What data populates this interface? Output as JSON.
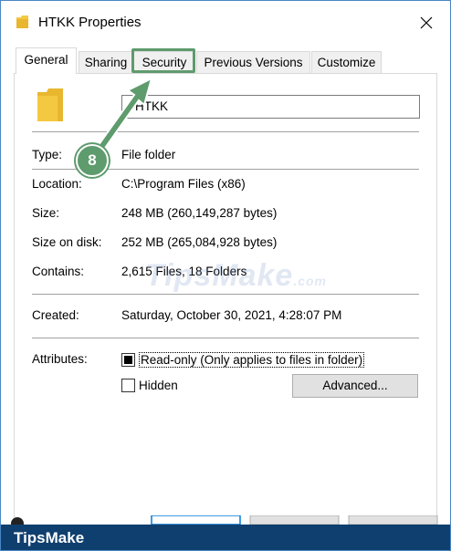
{
  "window": {
    "title": "HTKK Properties"
  },
  "tabs": [
    {
      "label": "General"
    },
    {
      "label": "Sharing"
    },
    {
      "label": "Security"
    },
    {
      "label": "Previous Versions"
    },
    {
      "label": "Customize"
    }
  ],
  "general": {
    "name_value": "HTKK",
    "rows": {
      "type": {
        "label": "Type:",
        "value": "File folder"
      },
      "location": {
        "label": "Location:",
        "value": "C:\\Program Files (x86)"
      },
      "size": {
        "label": "Size:",
        "value": "248 MB (260,149,287 bytes)"
      },
      "size_on_disk": {
        "label": "Size on disk:",
        "value": "252 MB (265,084,928 bytes)"
      },
      "contains": {
        "label": "Contains:",
        "value": "2,615 Files, 18 Folders"
      },
      "created": {
        "label": "Created:",
        "value": "Saturday, October 30, 2021, 4:28:07 PM"
      }
    },
    "attributes": {
      "label": "Attributes:",
      "readonly": {
        "label": "Read-only (Only applies to files in folder)",
        "checked": true
      },
      "hidden": {
        "label": "Hidden",
        "checked": false
      },
      "advanced_label": "Advanced..."
    }
  },
  "annotation": {
    "step": "8",
    "color": "#5e9b6d"
  },
  "watermark": {
    "text": "TipsMake",
    "suffix": ".com"
  },
  "brand": {
    "text": "TipsMake",
    "bar_color": "#0f3f6e"
  },
  "colors": {
    "folder": "#f5c842",
    "accent": "#5e9b6d",
    "window_border": "#4a87c5"
  }
}
